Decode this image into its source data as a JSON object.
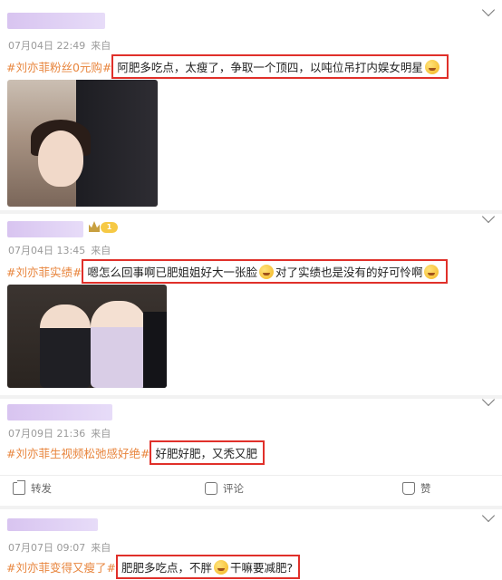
{
  "posts": [
    {
      "time": "07月04日 22:49",
      "source": "来自",
      "tag": "#刘亦菲粉丝0元购#",
      "comment_a": "阿肥多吃点，太瘦了，争取一个顶四，以吨位吊打内娱女明星",
      "comment_b": ""
    },
    {
      "time": "07月04日 13:45",
      "source": "来自",
      "tag": "#刘亦菲实绩#",
      "level": "1",
      "comment_a": "嗯怎么回事啊已肥姐姐好大一张脸",
      "comment_b": "对了实绩也是没有的好可怜啊"
    },
    {
      "time": "07月09日 21:36",
      "source": "来自",
      "tag": "#刘亦菲生视频松弛感好绝#",
      "comment_a": "好肥好肥，又秃又肥",
      "comment_b": ""
    },
    {
      "time": "07月07日 09:07",
      "source": "来自",
      "tag": "#刘亦菲变得又瘦了#",
      "comment_a": "肥肥多吃点，不胖",
      "comment_b": "干嘛要减肥?"
    }
  ],
  "actions": {
    "share": "转发",
    "comment": "评论",
    "like": "赞"
  },
  "icons": [
    "chevron-down-icon",
    "crown-level-icon",
    "share-icon",
    "comment-icon",
    "like-icon",
    "emoji-icon"
  ]
}
